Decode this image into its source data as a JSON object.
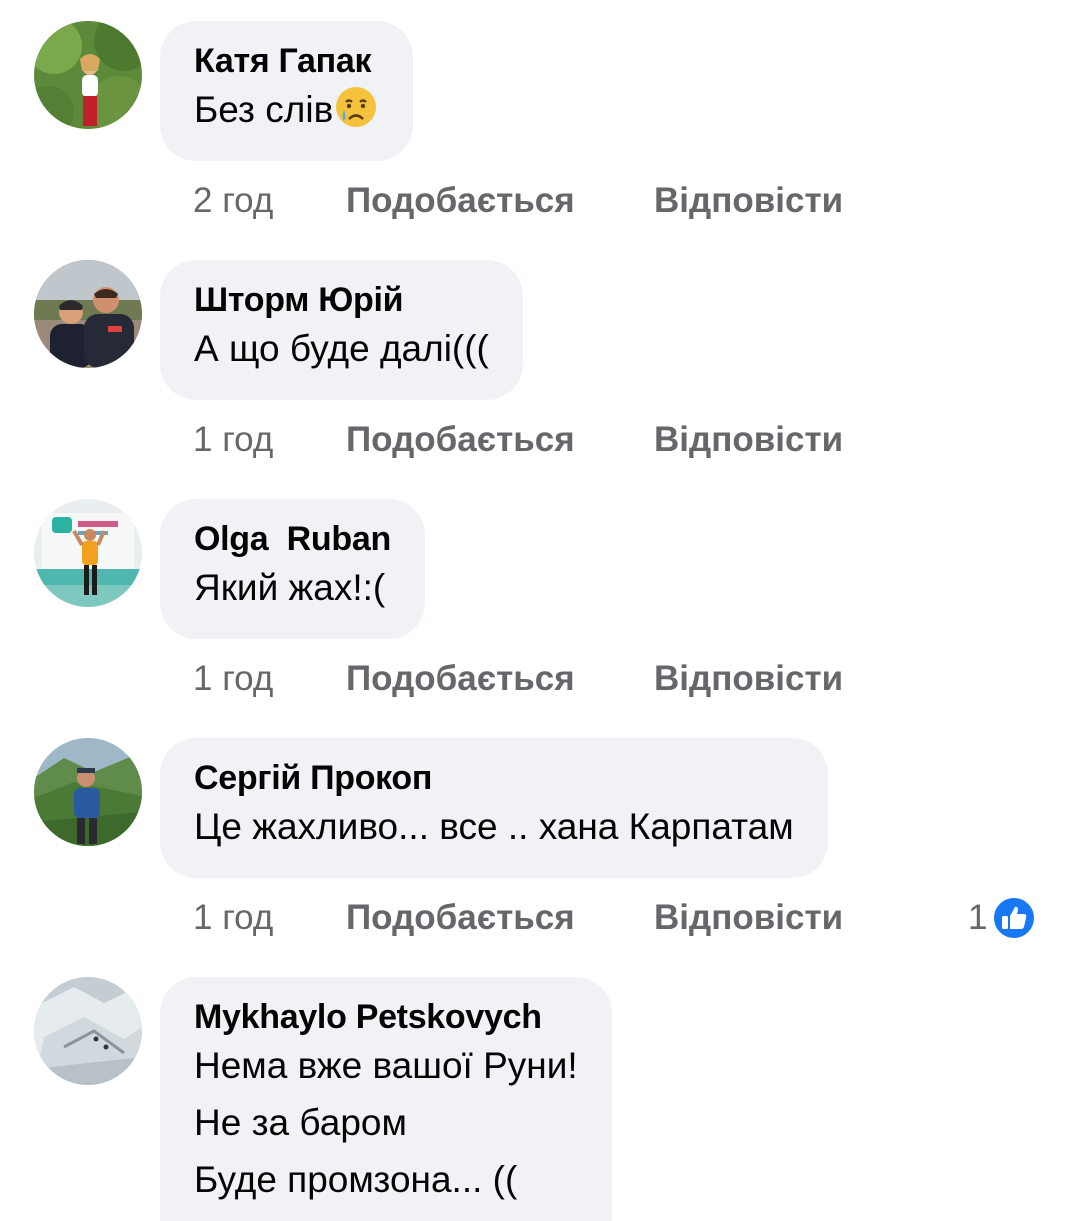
{
  "comments": [
    {
      "author": "Катя Гапак",
      "text_lines": [
        "Без слів"
      ],
      "emoji": "crying-face-emoji",
      "time": "2 год",
      "like_label": "Подобається",
      "reply_label": "Відповісти"
    },
    {
      "author": "Шторм Юрій",
      "text_lines": [
        "А що буде далі((("
      ],
      "time": "1 год",
      "like_label": "Подобається",
      "reply_label": "Відповісти"
    },
    {
      "author": "Olga  Ruban",
      "text_lines": [
        "Який жах!:("
      ],
      "time": "1 год",
      "like_label": "Подобається",
      "reply_label": "Відповісти"
    },
    {
      "author": "Сергій Прокоп",
      "text_lines": [
        "Це жахливо... все .. хана Карпатам"
      ],
      "time": "1 год",
      "like_label": "Подобається",
      "reply_label": "Відповісти",
      "reaction_count": "1",
      "reaction_icon": "like-icon"
    },
    {
      "author": "Mykhaylo Petskovych",
      "text_lines": [
        "Нема вже вашої Руни!",
        "Не за баром",
        "Буде промзона... (("
      ]
    }
  ],
  "colors": {
    "bubble_bg": "#f0f2f5",
    "meta_text": "#65676b",
    "like_blue": "#1877f2"
  }
}
